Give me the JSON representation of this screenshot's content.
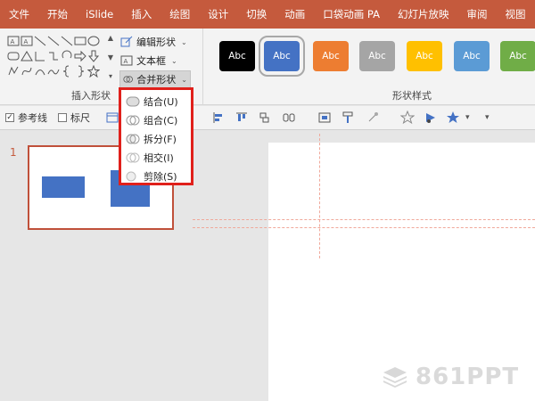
{
  "tabs": [
    "文件",
    "开始",
    "iSlide",
    "插入",
    "绘图",
    "设计",
    "切换",
    "动画",
    "口袋动画 PA",
    "幻灯片放映",
    "审阅",
    "视图"
  ],
  "ribbon": {
    "insert_group_label": "插入形状",
    "edit_shape_label": "编辑形状",
    "textbox_label": "文本框",
    "merge_shapes_label": "合并形状",
    "style_group_label": "形状样式",
    "style_swatches": [
      {
        "label": "Abc",
        "color": "#000000"
      },
      {
        "label": "Abc",
        "color": "#4472c4"
      },
      {
        "label": "Abc",
        "color": "#ed7d31"
      },
      {
        "label": "Abc",
        "color": "#a5a5a5"
      },
      {
        "label": "Abc",
        "color": "#ffc000"
      },
      {
        "label": "Abc",
        "color": "#5b9bd5"
      },
      {
        "label": "Abc",
        "color": "#70ad47"
      }
    ]
  },
  "toolbar": {
    "guides_label": "参考线",
    "ruler_label": "标尺"
  },
  "merge_menu": {
    "items": [
      "结合(U)",
      "组合(C)",
      "拆分(F)",
      "相交(I)",
      "剪除(S)"
    ]
  },
  "slides": {
    "number": "1"
  },
  "watermark": "861PPT",
  "colors": {
    "accent": "#c55a3d",
    "shape_fill": "#4472c4",
    "menu_highlight": "#e0201b"
  }
}
